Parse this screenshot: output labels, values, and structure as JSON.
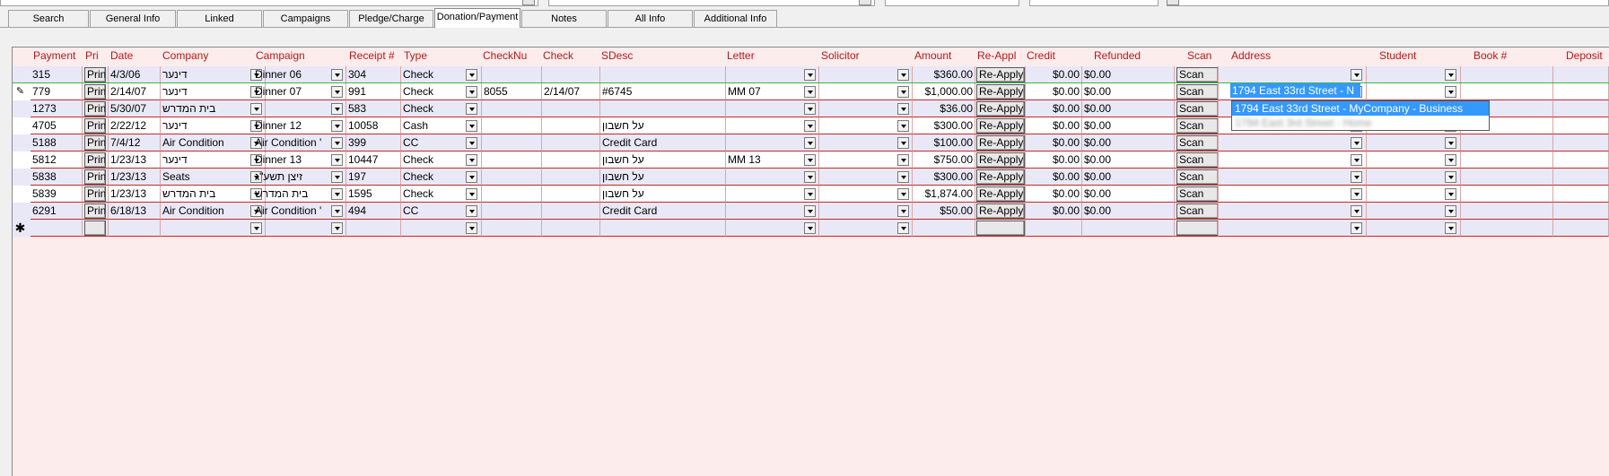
{
  "tabs": [
    {
      "label": "Search"
    },
    {
      "label": "General Info"
    },
    {
      "label": "Linked"
    },
    {
      "label": "Campaigns"
    },
    {
      "label": "Pledge/Charge"
    },
    {
      "label": "Donation/Payment"
    },
    {
      "label": "Notes"
    },
    {
      "label": "All Info"
    },
    {
      "label": "Additional Info"
    }
  ],
  "columns": {
    "payment": "Payment",
    "pri": "Pri",
    "date": "Date",
    "company": "Company",
    "campaign": "Campaign",
    "receipt": "Receipt #",
    "type": "Type",
    "checknum": "CheckNu",
    "check": "Check",
    "sdesc": "SDesc",
    "letter": "Letter",
    "solicitor": "Solicitor",
    "amount": "Amount",
    "reapply": "Re-Appl",
    "credit": "Credit",
    "refunded": "Refunded",
    "scan": "Scan",
    "address": "Address",
    "student": "Student",
    "book": "Book #",
    "deposit": "Deposit"
  },
  "buttons": {
    "print": "Prin",
    "reapply": "Re-Apply",
    "scan": "Scan"
  },
  "rows": [
    {
      "payment": "315",
      "date": "4/3/06",
      "company": "דינער",
      "campaign": "Dinner 06",
      "receipt": "304",
      "type": "Check",
      "checknum": "",
      "check": "",
      "sdesc": "",
      "letter": "",
      "amount": "$360.00",
      "credit": "$0.00",
      "refunded": "$0.00",
      "address": ""
    },
    {
      "payment": "779",
      "date": "2/14/07",
      "company": "דינער",
      "campaign": "Dinner 07",
      "receipt": "991",
      "type": "Check",
      "checknum": "8055",
      "check": "2/14/07",
      "sdesc": "#6745",
      "letter": "MM 07",
      "amount": "$1,000.00",
      "credit": "$0.00",
      "refunded": "$0.00",
      "address": "1794 East 33rd Street - N"
    },
    {
      "payment": "1273",
      "date": "5/30/07",
      "company": "בית המדרש",
      "campaign": "",
      "receipt": "583",
      "type": "Check",
      "checknum": "",
      "check": "",
      "sdesc": "",
      "letter": "",
      "amount": "$36.00",
      "credit": "$0.00",
      "refunded": "$0.00",
      "address": ""
    },
    {
      "payment": "4705",
      "date": "2/22/12",
      "company": "דינער",
      "campaign": "Dinner 12",
      "receipt": "10058",
      "type": "Cash",
      "checknum": "",
      "check": "",
      "sdesc": "על חשבון",
      "letter": "",
      "amount": "$300.00",
      "credit": "$0.00",
      "refunded": "$0.00",
      "address": ""
    },
    {
      "payment": "5188",
      "date": "7/4/12",
      "company": "Air Condition",
      "campaign": "Air Condition '",
      "receipt": "399",
      "type": "CC",
      "checknum": "",
      "check": "",
      "sdesc": "Credit Card",
      "letter": "",
      "amount": "$100.00",
      "credit": "$0.00",
      "refunded": "$0.00",
      "address": ""
    },
    {
      "payment": "5812",
      "date": "1/23/13",
      "company": "דינער",
      "campaign": "Dinner 13",
      "receipt": "10447",
      "type": "Check",
      "checknum": "",
      "check": "",
      "sdesc": "על חשבון",
      "letter": "MM 13",
      "amount": "$750.00",
      "credit": "$0.00",
      "refunded": "$0.00",
      "address": ""
    },
    {
      "payment": "5838",
      "date": "1/23/13",
      "company": "Seats",
      "campaign": "זיצן תשע\"ג",
      "receipt": "197",
      "type": "Check",
      "checknum": "",
      "check": "",
      "sdesc": "על חשבון",
      "letter": "",
      "amount": "$300.00",
      "credit": "$0.00",
      "refunded": "$0.00",
      "address": ""
    },
    {
      "payment": "5839",
      "date": "1/23/13",
      "company": "בית המדרש",
      "campaign": "בית המדרש",
      "receipt": "1595",
      "type": "Check",
      "checknum": "",
      "check": "",
      "sdesc": "על חשבון",
      "letter": "",
      "amount": "$1,874.00",
      "credit": "$0.00",
      "refunded": "$0.00",
      "address": ""
    },
    {
      "payment": "6291",
      "date": "6/18/13",
      "company": "Air Condition",
      "campaign": "Air Condition '",
      "receipt": "494",
      "type": "CC",
      "checknum": "",
      "check": "",
      "sdesc": "Credit Card",
      "letter": "",
      "amount": "$50.00",
      "credit": "$0.00",
      "refunded": "$0.00",
      "address": ""
    }
  ],
  "row_markers": {
    "editing": "✎",
    "new": "✱"
  },
  "address_dropdown": {
    "options": [
      "1794 East 33rd Street - MyCompany - Business",
      "1794 East 3rd Street - Home"
    ]
  },
  "colors": {
    "header_text": "#b11a1a",
    "highlight": "#3399ff",
    "sheet_background": "#fdecec",
    "row_border": "#c62828"
  }
}
